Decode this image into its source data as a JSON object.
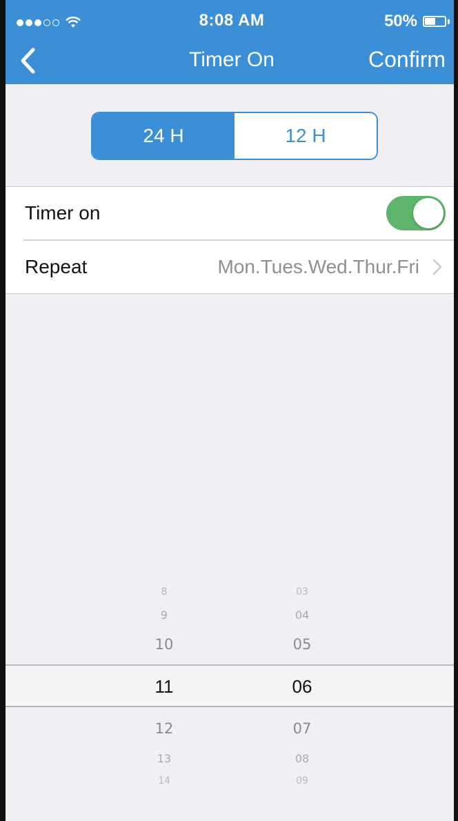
{
  "status_bar": {
    "time": "8:08 AM",
    "battery_percent": "50%",
    "signal_bars_filled": 3,
    "signal_bars_total": 5,
    "battery_level": 0.5
  },
  "nav": {
    "title": "Timer On",
    "confirm_label": "Confirm",
    "back_icon": "chevron-left-icon"
  },
  "format_toggle": {
    "options": [
      "24 H",
      "12 H"
    ],
    "selected": "24 H"
  },
  "settings": {
    "timer_on_label": "Timer on",
    "timer_on_enabled": true,
    "repeat_label": "Repeat",
    "repeat_value": "Mon.Tues.Wed.Thur.Fri"
  },
  "picker": {
    "hours": [
      "8",
      "9",
      "10",
      "11",
      "12",
      "13",
      "14"
    ],
    "minutes": [
      "03",
      "04",
      "05",
      "06",
      "07",
      "08",
      "09"
    ],
    "selected_hour": "11",
    "selected_minute": "06"
  },
  "colors": {
    "accent": "#3a8fd6",
    "toggle_on": "#5cb56a",
    "background": "#efeff4"
  }
}
